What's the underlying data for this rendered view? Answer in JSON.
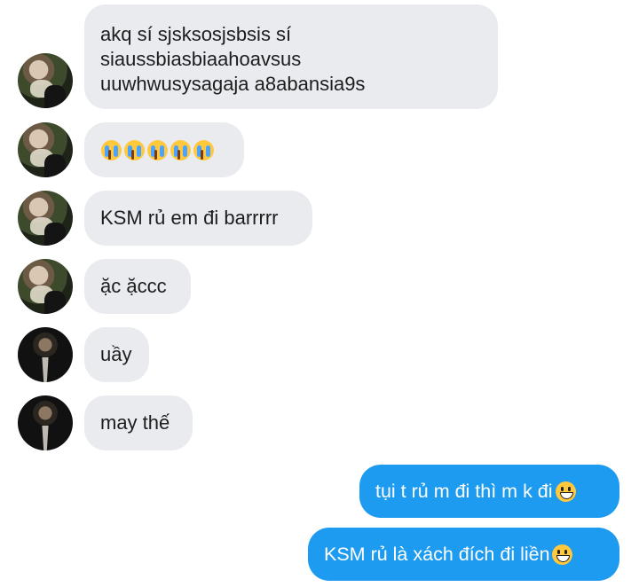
{
  "messages": [
    {
      "dir": "in",
      "avatar": "avatar-a",
      "lines": [
        "akq sí sjsksosjsbsis sí",
        "siaussbiasbiaahoavsus",
        "uuwhwusysagaja a8abansia9s"
      ]
    },
    {
      "dir": "in",
      "avatar": "avatar-a",
      "emoji": "crying-face-emoji",
      "emoji_count": 5
    },
    {
      "dir": "in",
      "avatar": "avatar-a",
      "text": "KSM rủ em đi barrrrr"
    },
    {
      "dir": "in",
      "avatar": "avatar-a",
      "text": "ặc ặccc"
    },
    {
      "dir": "in",
      "avatar": "avatar-b",
      "text": "uầy"
    },
    {
      "dir": "in",
      "avatar": "avatar-b",
      "text": "may thế"
    },
    {
      "dir": "out",
      "text": "tụi t rủ m đi thì m k đi",
      "emoji": "grinning-face-emoji"
    },
    {
      "dir": "out",
      "text": "KSM rủ là xách đích đi liền",
      "emoji": "grinning-face-emoji"
    }
  ],
  "colors": {
    "incoming_bubble": "#e9ebef",
    "outgoing_bubble": "#1d9bf0",
    "text_dark": "#1d1d1f",
    "text_light": "#ffffff"
  }
}
